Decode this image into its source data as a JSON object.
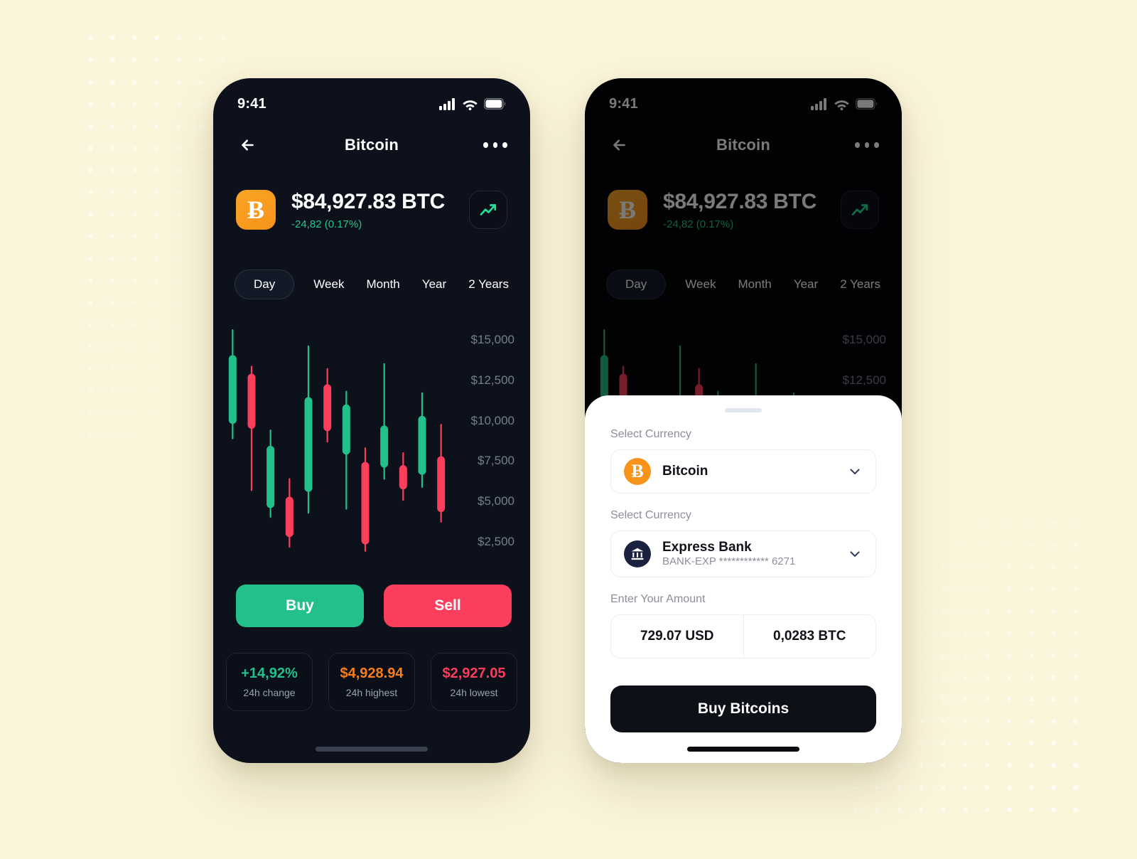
{
  "theme": {
    "page_bg": "#fbf5dc",
    "phone_bg": "#0d111c",
    "green": "#22c08a",
    "red": "#fb3e5c",
    "orange": "#f7931a",
    "muted": "#767d8d"
  },
  "status_bar": {
    "time": "9:41",
    "icons": [
      "cellular-icon",
      "wifi-icon",
      "battery-icon"
    ]
  },
  "nav": {
    "back_icon": "arrow-left-icon",
    "title": "Bitcoin",
    "more_icon": "more-horizontal-icon"
  },
  "asset": {
    "logo_symbol": "Ƀ",
    "logo_name": "bitcoin-logo",
    "price": "$84,927.83 BTC",
    "change": "-24,82 (0.17%)",
    "trend_icon": "trending-up-icon"
  },
  "periods": [
    {
      "label": "Day",
      "active": true
    },
    {
      "label": "Week",
      "active": false
    },
    {
      "label": "Month",
      "active": false
    },
    {
      "label": "Year",
      "active": false
    },
    {
      "label": "2 Years",
      "active": false
    }
  ],
  "actions": {
    "buy_label": "Buy",
    "sell_label": "Sell"
  },
  "stats": [
    {
      "value": "+14,92%",
      "label": "24h change",
      "color": "#22c08a"
    },
    {
      "value": "$4,928.94",
      "label": "24h highest",
      "color": "#f77f1a"
    },
    {
      "value": "$2,927.05",
      "label": "24h  lowest",
      "color": "#fb3e5c"
    }
  ],
  "sheet": {
    "currency_label": "Select Currency",
    "currency_value": "Bitcoin",
    "currency_icon": "bitcoin-icon",
    "bank_label": "Select Currency",
    "bank_value": "Express Bank",
    "bank_sub": "BANK-EXP ************ 6271",
    "bank_icon": "bank-icon",
    "amount_label": "Enter Your Amount",
    "amount_usd": "729.07 USD",
    "amount_btc": "0,0283 BTC",
    "submit_label": "Buy Bitcoins",
    "chevron_icon": "chevron-down-icon"
  },
  "chart_data": {
    "type": "candlestick",
    "title": "Bitcoin price — Day",
    "xlabel": "",
    "ylabel": "",
    "ylim": [
      1500,
      16000
    ],
    "grid": false,
    "y_ticks": [
      {
        "label": "$15,000",
        "value": 15000
      },
      {
        "label": "$12,500",
        "value": 12500
      },
      {
        "label": "$10,000",
        "value": 10000
      },
      {
        "label": "$7,500",
        "value": 7500
      },
      {
        "label": "$5,000",
        "value": 5000
      },
      {
        "label": "$2,500",
        "value": 2500
      }
    ],
    "colors": {
      "up": "#22c08a",
      "down": "#fb3e5c"
    },
    "candles": [
      {
        "open": 9800,
        "close": 14050,
        "low": 8900,
        "high": 15600,
        "dir": "up"
      },
      {
        "open": 12900,
        "close": 9500,
        "low": 5700,
        "high": 13350,
        "dir": "down"
      },
      {
        "open": 4600,
        "close": 8450,
        "low": 4050,
        "high": 9400,
        "dir": "up"
      },
      {
        "open": 2800,
        "close": 5300,
        "low": 2200,
        "high": 6400,
        "dir": "down"
      },
      {
        "open": 5600,
        "close": 11450,
        "low": 4300,
        "high": 14600,
        "dir": "up"
      },
      {
        "open": 9350,
        "close": 12250,
        "low": 8700,
        "high": 13200,
        "dir": "down"
      },
      {
        "open": 7900,
        "close": 11000,
        "low": 4550,
        "high": 11800,
        "dir": "up"
      },
      {
        "open": 2350,
        "close": 7450,
        "low": 1950,
        "high": 8300,
        "dir": "down"
      },
      {
        "open": 7100,
        "close": 9700,
        "low": 6400,
        "high": 13500,
        "dir": "up"
      },
      {
        "open": 5750,
        "close": 7250,
        "low": 5100,
        "high": 8000,
        "dir": "down"
      },
      {
        "open": 6650,
        "close": 10300,
        "low": 5900,
        "high": 11700,
        "dir": "up"
      },
      {
        "open": 4350,
        "close": 7800,
        "low": 3750,
        "high": 9750,
        "dir": "down"
      }
    ]
  }
}
